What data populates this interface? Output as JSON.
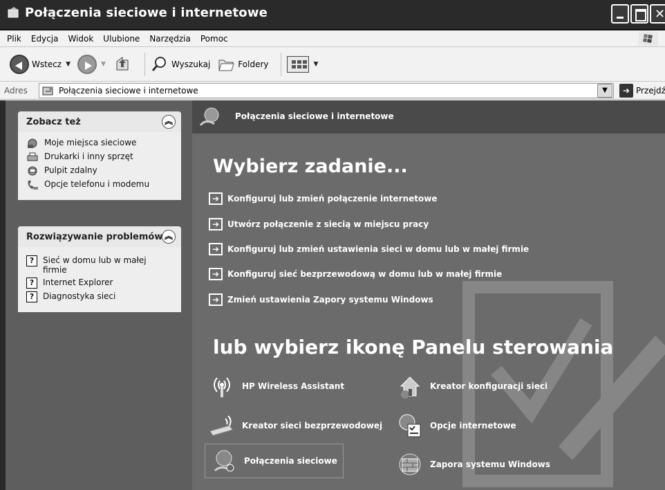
{
  "window": {
    "title": "Połączenia sieciowe i internetowe"
  },
  "menu": [
    "Plik",
    "Edycja",
    "Widok",
    "Ulubione",
    "Narzędzia",
    "Pomoc"
  ],
  "toolbar": {
    "back_label": "Wstecz",
    "search_label": "Wyszukaj",
    "folders_label": "Foldery"
  },
  "address": {
    "label": "Adres",
    "value": "Połączenia sieciowe i internetowe",
    "go_label": "Przejdź"
  },
  "see_also": {
    "title": "Zobacz też",
    "items": [
      {
        "label": "Moje miejsca sieciowe",
        "icon": "network-places-icon"
      },
      {
        "label": "Drukarki i inny sprzęt",
        "icon": "printer-icon"
      },
      {
        "label": "Pulpit zdalny",
        "icon": "remote-desktop-icon"
      },
      {
        "label": "Opcje telefonu i modemu",
        "icon": "phone-modem-icon"
      }
    ]
  },
  "troubleshoot": {
    "title": "Rozwiązywanie problemów",
    "items": [
      {
        "label": "Sieć w domu lub w małej firmie",
        "icon": "help-icon"
      },
      {
        "label": "Internet Explorer",
        "icon": "help-icon"
      },
      {
        "label": "Diagnostyka sieci",
        "icon": "help-icon"
      }
    ]
  },
  "content": {
    "header": "Połączenia sieciowe i internetowe",
    "pick_task": "Wybierz zadanie...",
    "tasks": [
      "Konfiguruj lub zmień połączenie internetowe",
      "Utwórz połączenie z siecią w miejscu pracy",
      "Konfiguruj lub zmień ustawienia sieci w domu lub w małej firmie",
      "Konfiguruj sieć bezprzewodową w domu lub w małej firmie",
      "Zmień ustawienia Zapory systemu Windows"
    ],
    "pick_icon": "lub wybierz ikonę Panelu sterowania",
    "icons": [
      {
        "label": "HP Wireless Assistant",
        "icon": "wireless-antenna-icon"
      },
      {
        "label": "Kreator konfiguracji sieci",
        "icon": "home-network-icon"
      },
      {
        "label": "Kreator sieci bezprzewodowej",
        "icon": "wireless-usb-icon"
      },
      {
        "label": "Opcje internetowe",
        "icon": "internet-options-icon"
      },
      {
        "label": "Połączenia sieciowe",
        "icon": "network-connections-icon"
      },
      {
        "label": "Zapora systemu Windows",
        "icon": "firewall-icon"
      }
    ]
  }
}
